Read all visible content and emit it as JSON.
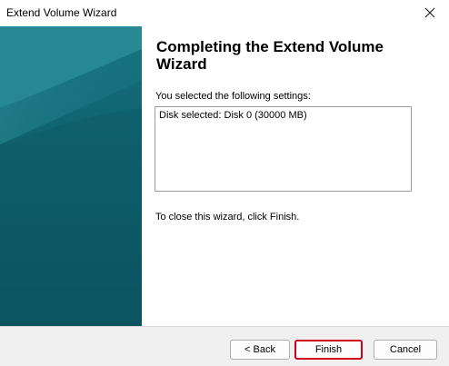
{
  "window": {
    "title": "Extend Volume Wizard"
  },
  "titlebar": {
    "close_icon": "close-icon"
  },
  "content": {
    "heading": "Completing the Extend Volume Wizard",
    "settings_label": "You selected the following settings:",
    "settings_lines": [
      "Disk selected: Disk 0 (30000 MB)"
    ],
    "close_hint": "To close this wizard, click Finish."
  },
  "buttons": {
    "back": "< Back",
    "finish": "Finish",
    "cancel": "Cancel"
  },
  "colors": {
    "sidebar_dark": "#0e5f6d",
    "sidebar_light": "#2a8a96",
    "highlight_border": "#d0021b",
    "footer_bg": "#f0f0f0"
  }
}
